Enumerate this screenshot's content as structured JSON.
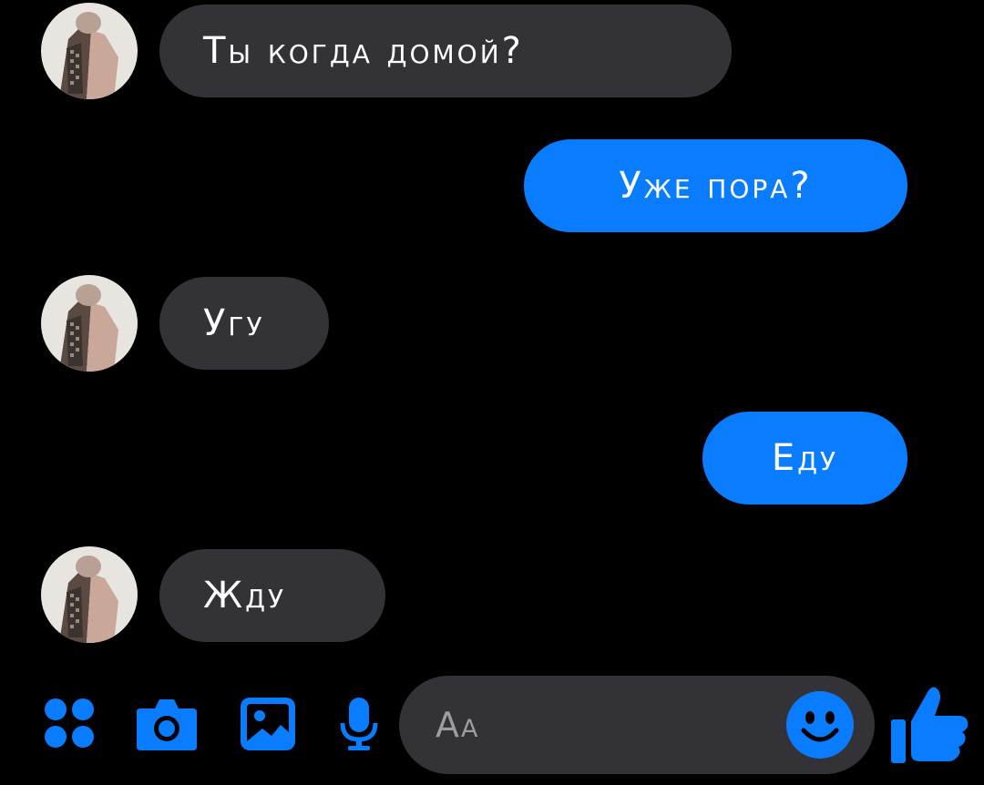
{
  "messages": [
    {
      "from": "contact",
      "text": "Ты когда домой?"
    },
    {
      "from": "me",
      "text": "Уже пора?"
    },
    {
      "from": "contact",
      "text": "Угу"
    },
    {
      "from": "me",
      "text": "Еду"
    },
    {
      "from": "contact",
      "text": "Жду"
    }
  ],
  "composer": {
    "placeholder": "Аа"
  },
  "toolbar": {
    "icons": [
      "menu-icon",
      "camera-icon",
      "gallery-icon",
      "microphone-icon",
      "emoji-icon",
      "like-icon"
    ]
  },
  "colors": {
    "background": "#000000",
    "incoming_bubble": "#333236",
    "outgoing_bubble": "#0a7cff",
    "accent": "#0a7cff",
    "text": "#ffffff",
    "placeholder": "#9d9da1"
  }
}
